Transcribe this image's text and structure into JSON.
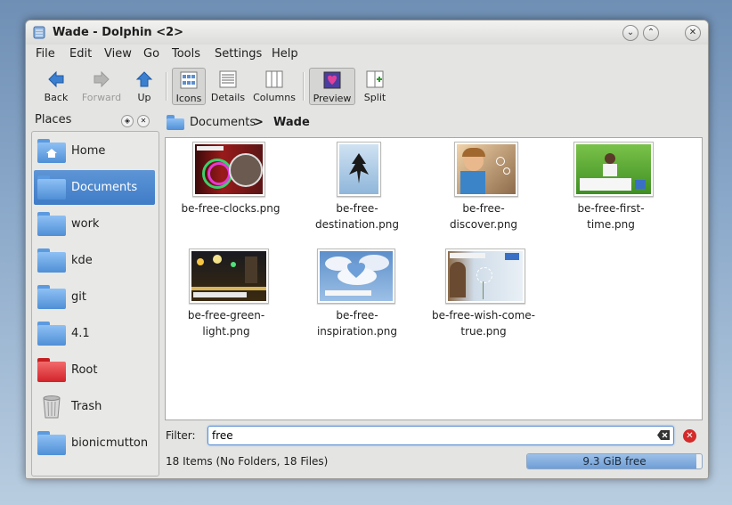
{
  "window": {
    "title": "Wade - Dolphin <2>"
  },
  "menu": [
    "File",
    "Edit",
    "View",
    "Go",
    "Tools",
    "Settings",
    "Help"
  ],
  "toolbar": {
    "back": "Back",
    "forward": "Forward",
    "up": "Up",
    "icons": "Icons",
    "details": "Details",
    "columns": "Columns",
    "preview": "Preview",
    "split": "Split"
  },
  "places": {
    "title": "Places",
    "items": [
      {
        "label": "Home",
        "icon": "home-folder-icon"
      },
      {
        "label": "Documents",
        "icon": "folder-icon"
      },
      {
        "label": "work",
        "icon": "folder-icon"
      },
      {
        "label": "kde",
        "icon": "folder-icon"
      },
      {
        "label": "git",
        "icon": "folder-icon"
      },
      {
        "label": "4.1",
        "icon": "folder-icon"
      },
      {
        "label": "Root",
        "icon": "red-folder-icon"
      },
      {
        "label": "Trash",
        "icon": "trash-icon"
      },
      {
        "label": "bionicmutton",
        "icon": "folder-icon"
      }
    ]
  },
  "breadcrumb": {
    "parent": "Documents",
    "separator": ">",
    "current": "Wade"
  },
  "files": [
    {
      "line1": "be-free-clocks.png",
      "line2": ""
    },
    {
      "line1": "be-free-",
      "line2": "destination.png"
    },
    {
      "line1": "be-free-",
      "line2": "discover.png"
    },
    {
      "line1": "be-free-first-",
      "line2": "time.png"
    },
    {
      "line1": "be-free-green-",
      "line2": "light.png"
    },
    {
      "line1": "be-free-",
      "line2": "inspiration.png"
    },
    {
      "line1": "be-free-wish-come-",
      "line2": "true.png"
    }
  ],
  "filter": {
    "label": "Filter:",
    "value": "free"
  },
  "status": {
    "text": "18 Items (No Folders, 18 Files)",
    "space": "9.3 GiB free",
    "used_fraction": 0.97
  },
  "colors": {
    "selection": "#4a86cf",
    "folder": "#5c9ae0",
    "root_folder": "#e0262a"
  }
}
